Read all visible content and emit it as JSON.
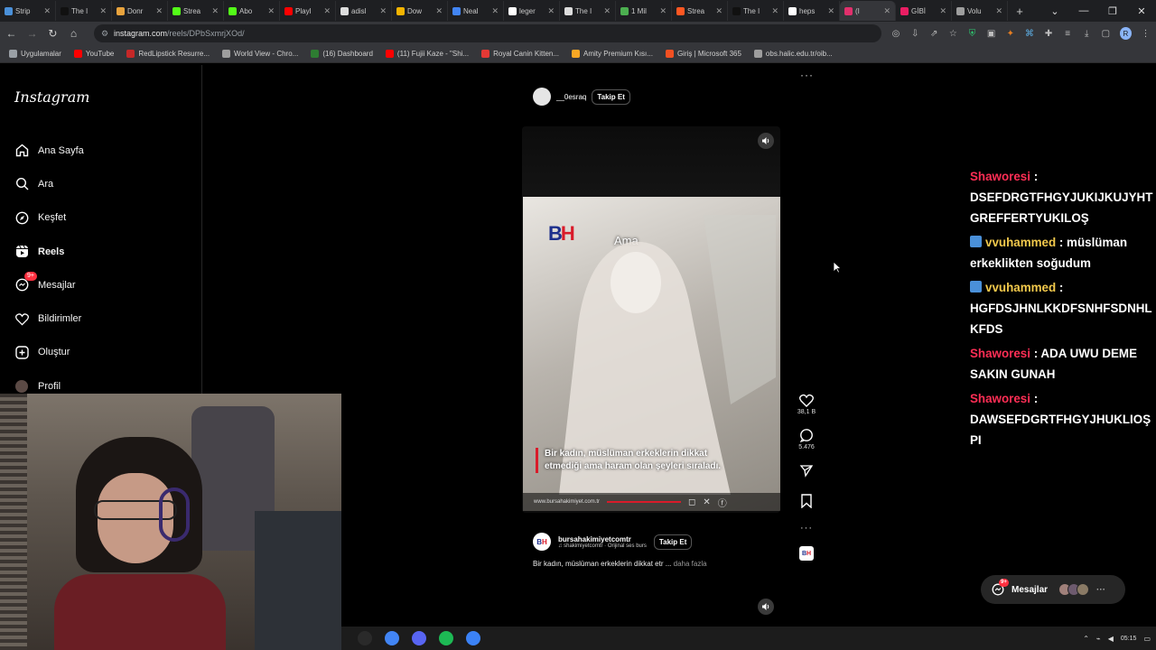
{
  "browser": {
    "tabs": [
      {
        "title": "Strip",
        "color": "#4a90d9"
      },
      {
        "title": "The I",
        "color": "#111111"
      },
      {
        "title": "Donr",
        "color": "#e8a33d"
      },
      {
        "title": "Strea",
        "color": "#53fc18"
      },
      {
        "title": "Abo",
        "color": "#53fc18"
      },
      {
        "title": "Playl",
        "color": "#ff0000"
      },
      {
        "title": "adisl",
        "color": "#dddddd"
      },
      {
        "title": "Dow",
        "color": "#f4b400"
      },
      {
        "title": "Neal",
        "color": "#4285f4"
      },
      {
        "title": "leger",
        "color": "#ffffff"
      },
      {
        "title": "The I",
        "color": "#dddddd"
      },
      {
        "title": "1 Mil",
        "color": "#4caf50"
      },
      {
        "title": "Strea",
        "color": "#ff5722"
      },
      {
        "title": "The I",
        "color": "#111111"
      },
      {
        "title": "heps",
        "color": "#ffffff"
      },
      {
        "title": "(I",
        "color": "#e1306c",
        "active": true
      },
      {
        "title": "GİBİ",
        "color": "#e91e63"
      },
      {
        "title": "Volu",
        "color": "#9e9e9e"
      }
    ],
    "url_host": "instagram.com",
    "url_path": "/reels/DPbSxmrjXOd/",
    "window_controls": [
      "⌄",
      "—",
      "❐",
      "✕"
    ],
    "bookmarks": [
      {
        "label": "Uygulamalar",
        "color": "#9aa0a6"
      },
      {
        "label": "YouTube",
        "color": "#ff0000"
      },
      {
        "label": "RedLipstick Resurre...",
        "color": "#c62828"
      },
      {
        "label": "World View - Chro...",
        "color": "#9e9e9e"
      },
      {
        "label": "(16) Dashboard",
        "color": "#2e7d32"
      },
      {
        "label": "(11) Fujii Kaze - \"Shi...",
        "color": "#ff0000"
      },
      {
        "label": "Royal Canin Kitten...",
        "color": "#e53935"
      },
      {
        "label": "Amity Premium Kısı...",
        "color": "#f9a825"
      },
      {
        "label": "Giriş | Microsoft 365",
        "color": "#f25022"
      },
      {
        "label": "obs.halic.edu.tr/oib...",
        "color": "#9e9e9e"
      }
    ]
  },
  "instagram": {
    "logo": "Instagram",
    "nav": [
      {
        "label": "Ana Sayfa",
        "icon": "home-icon"
      },
      {
        "label": "Ara",
        "icon": "search-icon"
      },
      {
        "label": "Keşfet",
        "icon": "compass-icon"
      },
      {
        "label": "Reels",
        "icon": "reels-icon",
        "active": true
      },
      {
        "label": "Mesajlar",
        "icon": "messenger-icon",
        "badge": "9+"
      },
      {
        "label": "Bildirimler",
        "icon": "heart-icon"
      },
      {
        "label": "Oluştur",
        "icon": "plus-icon"
      },
      {
        "label": "Profil",
        "icon": "avatar-icon"
      }
    ],
    "top_post": {
      "username": "__0esraq",
      "follow": "Takip Et"
    },
    "reel": {
      "overlay_word": "Ama",
      "caption": "Bir kadın, müslüman erkeklerin dikkat etmediği ama haram olan şeyleri sıraladı.",
      "footer_site": "www.bursahakimiyet.com.tr",
      "likes": "38,1 B",
      "comments": "5.476",
      "username": "bursahakimiyetcomtr",
      "follow": "Takip Et",
      "audio": "shakimiyetcomtr · Orijinal ses   burs",
      "description": "Bir kadın, müslüman erkeklerin dikkat etr ...",
      "more_label": "daha fazla"
    },
    "messages_pill": {
      "label": "Mesajlar",
      "badge": "9+"
    }
  },
  "chat": [
    {
      "user": "Shaworesi",
      "text": "DSEFDRGTFHGYJUKIJKUJYHTGREFFERTYUKILOŞ",
      "prime": false,
      "color": "#ff2e55"
    },
    {
      "user": "vvuhammed",
      "text": "müslüman erkeklikten soğudum",
      "prime": true,
      "color": "#f2c94c"
    },
    {
      "user": "vvuhammed",
      "text": "HGFDSJHNLKKDFSNHFSDNHLKFDS",
      "prime": true,
      "color": "#f2c94c"
    },
    {
      "user": "Shaworesi",
      "text": "ADA UWU DEME SAKIN GUNAH",
      "prime": false,
      "color": "#ff2e55"
    },
    {
      "user": "Shaworesi",
      "text": "DAWSEFDGRTFHGYJHUKLIOŞPI",
      "prime": false,
      "color": "#ff2e55"
    }
  ],
  "taskbar": {
    "apps": [
      {
        "name": "obs-icon",
        "color": "#2a2a2a"
      },
      {
        "name": "chrome-icon",
        "color": "#4285f4"
      },
      {
        "name": "discord-icon",
        "color": "#5865f2"
      },
      {
        "name": "spotify-icon",
        "color": "#1db954"
      },
      {
        "name": "notepad-icon",
        "color": "#3b82f6"
      }
    ],
    "time": "05:15"
  }
}
